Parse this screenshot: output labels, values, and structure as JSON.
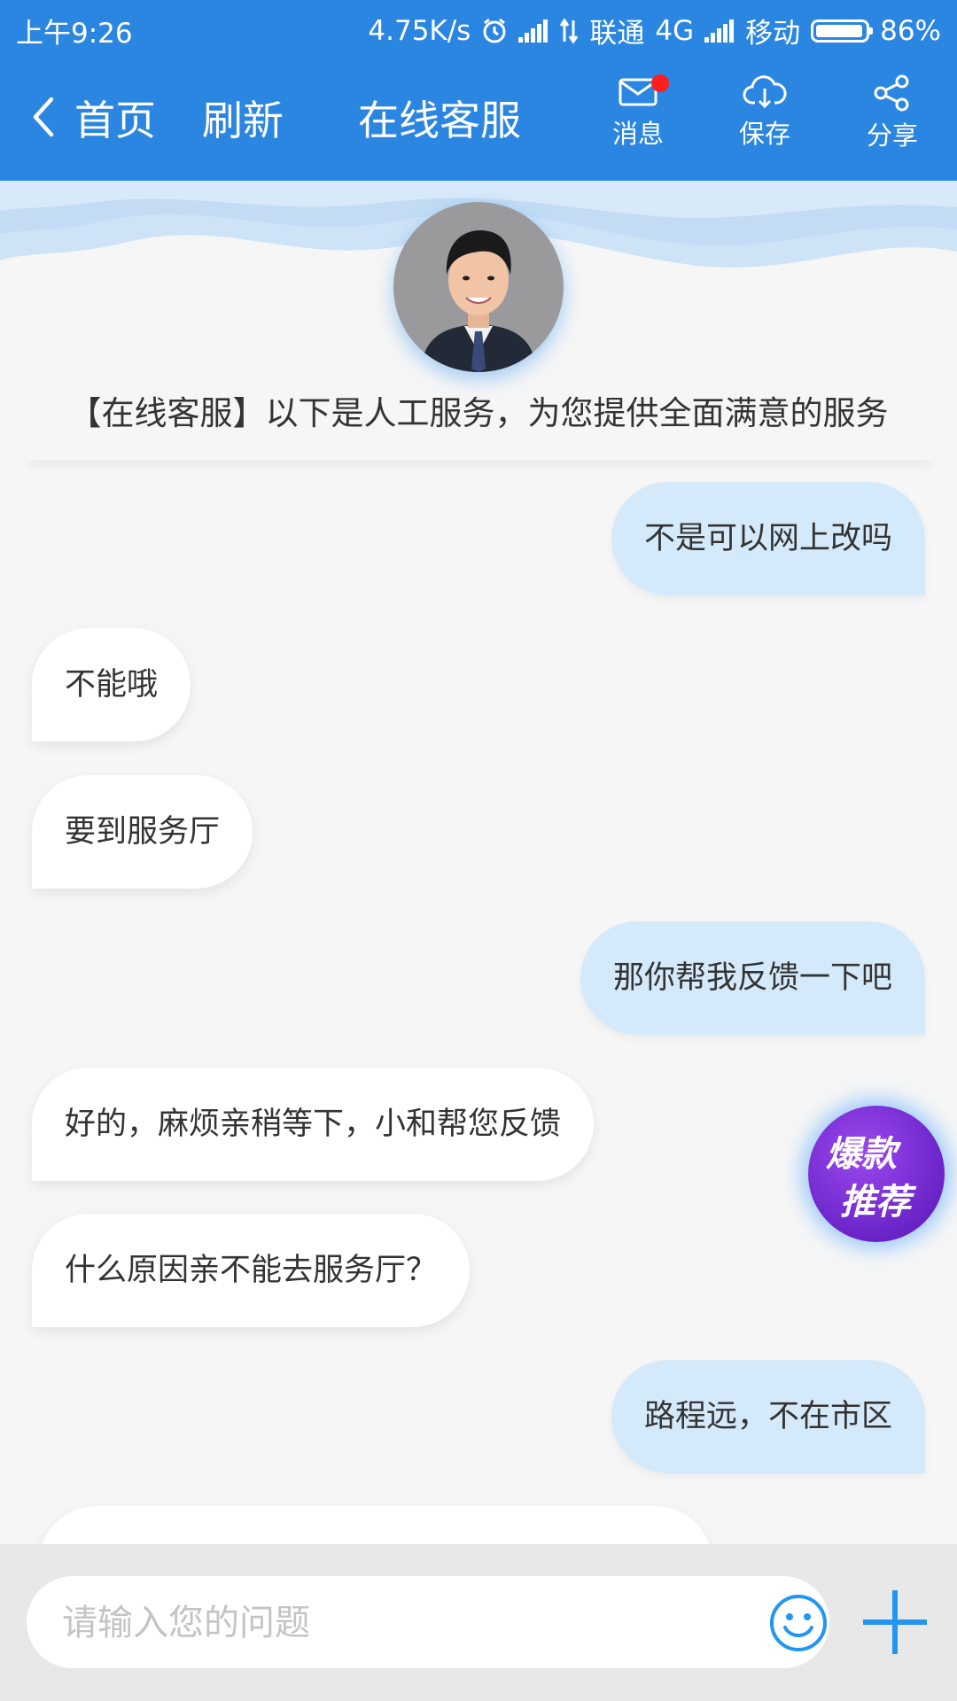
{
  "status_bar": {
    "time": "上午9:26",
    "network_speed": "4.75K/s",
    "carrier1": "联通",
    "network_type": "4G",
    "carrier2": "移动",
    "battery": "86%",
    "icons": [
      "alarm-icon",
      "signal-icon",
      "data-arrows-icon",
      "signal-icon",
      "battery-icon"
    ]
  },
  "nav": {
    "back_icon": "chevron-left-icon",
    "home_label": "首页",
    "refresh_label": "刷新",
    "title": "在线客服",
    "actions": [
      {
        "label": "消息",
        "icon": "mail-icon",
        "has_badge": true
      },
      {
        "label": "保存",
        "icon": "cloud-download-icon"
      },
      {
        "label": "分享",
        "icon": "share-icon"
      }
    ]
  },
  "header": {
    "avatar": "agent-avatar",
    "intro": "【在线客服】以下是人工服务，为您提供全面满意的服务"
  },
  "messages": [
    {
      "side": "right",
      "text": "不是可以网上改吗"
    },
    {
      "side": "left",
      "text": "不能哦"
    },
    {
      "side": "left",
      "text": "要到服务厅"
    },
    {
      "side": "right",
      "text": "那你帮我反馈一下吧"
    },
    {
      "side": "left",
      "text": "好的，麻烦亲稍等下，小和帮您反馈"
    },
    {
      "side": "left",
      "text": "什么原因亲不能去服务厅？"
    },
    {
      "side": "right",
      "text": "路程远，不在市区"
    }
  ],
  "promo": {
    "line1": "爆款",
    "line2": "推荐"
  },
  "input": {
    "placeholder": "请输入您的问题",
    "value": "",
    "emoji_icon": "smiley-icon",
    "plus_icon": "plus-icon"
  },
  "colors": {
    "brand_blue": "#2a86e0",
    "user_bubble": "#d4eafb",
    "agent_bubble": "#ffffff",
    "badge_red": "#ff1d1d",
    "promo_purple": "#7a30d8",
    "accent_icon": "#2196f3"
  }
}
